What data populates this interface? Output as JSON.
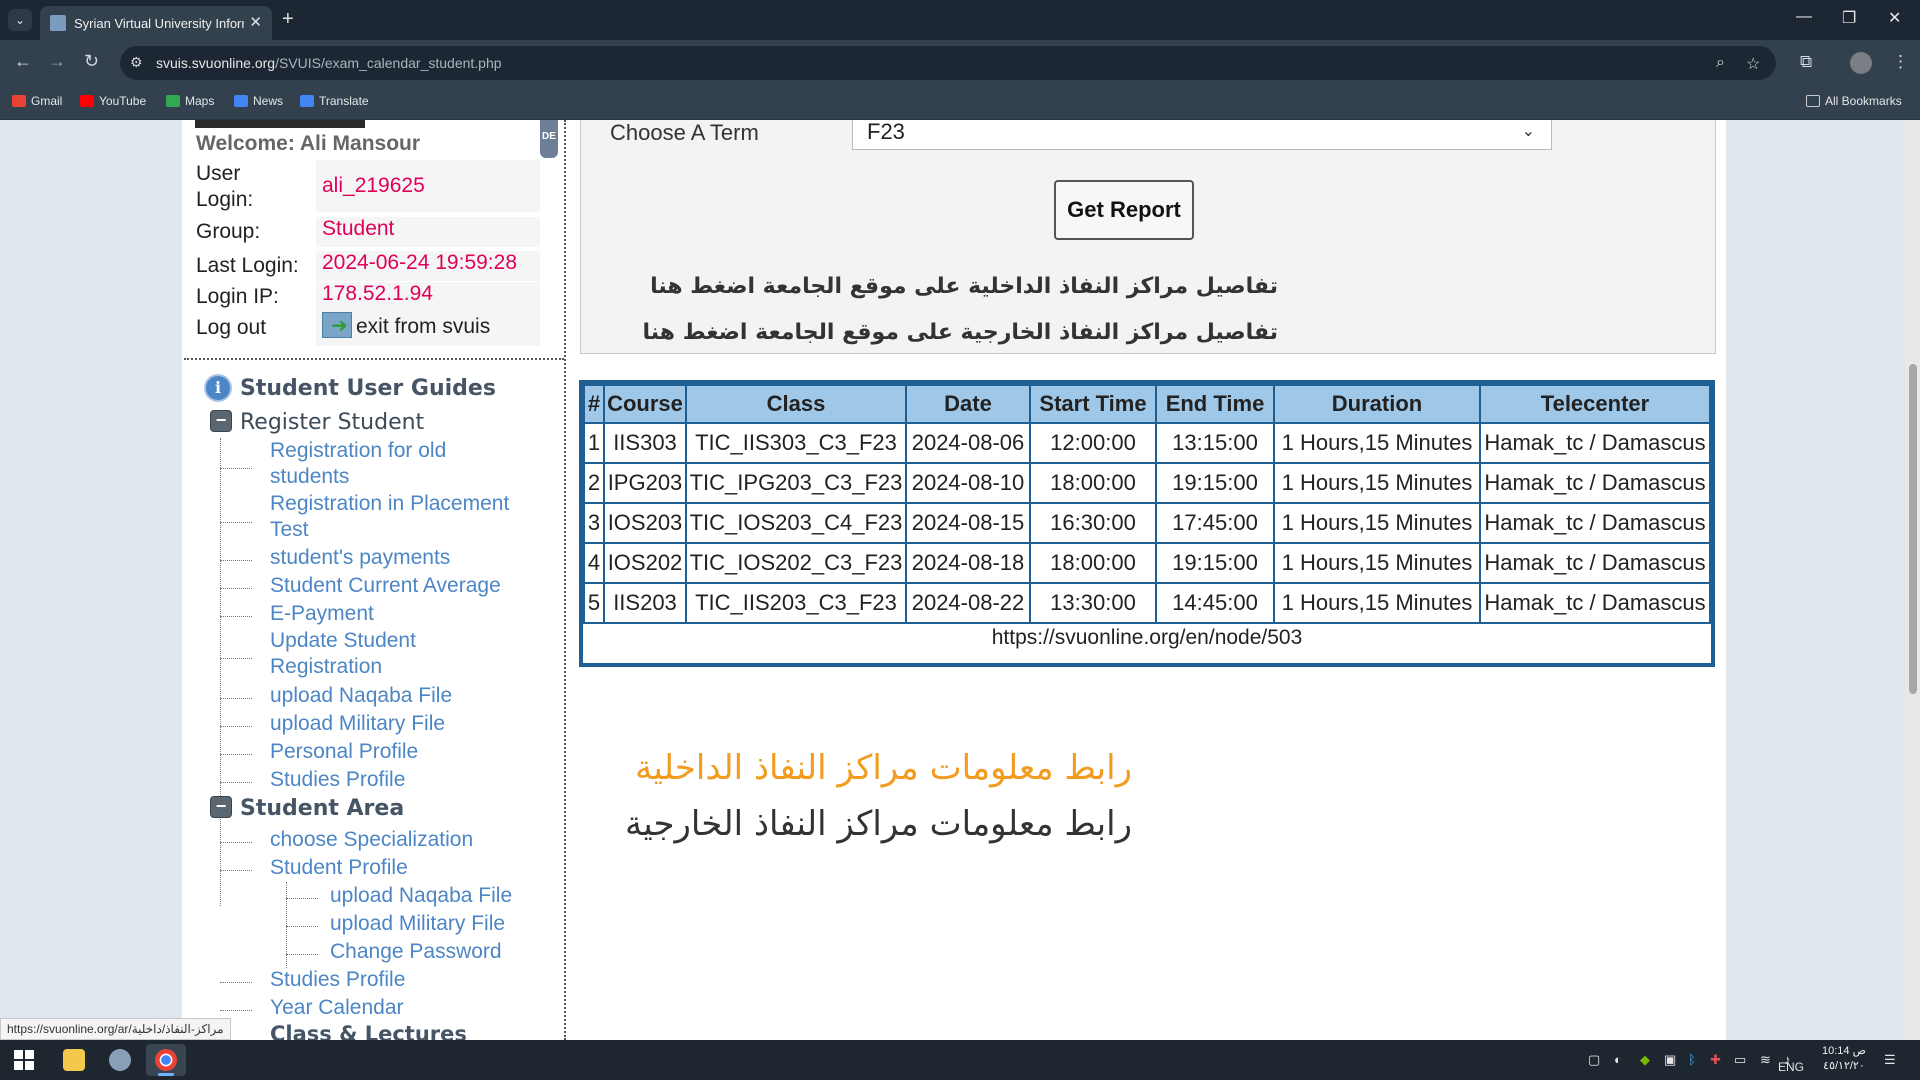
{
  "browser": {
    "tab_title": "Syrian Virtual University Informa",
    "new_tab": "+",
    "tab_close": "✕",
    "url_host": "svuis.svuonline.org",
    "url_path": "/SVUIS/exam_calendar_student.php",
    "window_controls": {
      "minimize": "—",
      "restore": "❐",
      "close": "✕"
    },
    "bookmarks": [
      {
        "label": "Gmail",
        "color": "#ea4335"
      },
      {
        "label": "YouTube",
        "color": "#ff0000"
      },
      {
        "label": "Maps",
        "color": "#34a853"
      },
      {
        "label": "News",
        "color": "#4285f4"
      },
      {
        "label": "Translate",
        "color": "#4285f4"
      }
    ],
    "all_bookmarks": "All Bookmarks"
  },
  "sidebar": {
    "side_tab": "DE",
    "welcome": "Welcome: Ali Mansour",
    "user_login_label_1": "User",
    "user_login_label_2": "Login:",
    "user_login": "ali_219625",
    "group_label": "Group:",
    "group": "Student",
    "last_login_label": "Last Login:",
    "last_login": "2024-06-24 19:59:28",
    "login_ip_label": "Login IP:",
    "login_ip": "178.52.1.94",
    "logout_label": "Log out",
    "logout_link": "exit from svuis",
    "guides_heading": "Student User Guides",
    "register_heading": "Register Student",
    "register_items": [
      "Registration for old",
      "students",
      "Registration in Placement",
      "Test",
      "student's payments",
      "Student Current Average",
      "E-Payment",
      "Update Student",
      "Registration",
      "upload Naqaba File",
      "upload Military File",
      "Personal Profile",
      "Studies Profile"
    ],
    "area_heading": "Student Area",
    "area_items": [
      "choose Specialization",
      "Student Profile"
    ],
    "profile_sub_items": [
      "upload Naqaba File",
      "upload Military File",
      "Change Password"
    ],
    "area_items_2": [
      "Studies Profile",
      "Year Calendar"
    ],
    "class_heading": "Class & Lectures"
  },
  "term": {
    "label": "Choose A Term",
    "selected": "F23",
    "button": "Get Report",
    "link_internal": "تفاصيل مراكز النفاذ الداخلية على موقع الجامعة اضغط هنا",
    "link_external": "تفاصيل مراكز النفاذ الخارجية على موقع الجامعة اضغط هنا"
  },
  "exam_table": {
    "headers": [
      "#",
      "Course",
      "Class",
      "Date",
      "Start Time",
      "End Time",
      "Duration",
      "Telecenter"
    ],
    "rows": [
      [
        "1",
        "IIS303",
        "TIC_IIS303_C3_F23",
        "2024-08-06",
        "12:00:00",
        "13:15:00",
        "1 Hours,15 Minutes",
        "Hamak_tc / Damascus"
      ],
      [
        "2",
        "IPG203",
        "TIC_IPG203_C3_F23",
        "2024-08-10",
        "18:00:00",
        "19:15:00",
        "1 Hours,15 Minutes",
        "Hamak_tc / Damascus"
      ],
      [
        "3",
        "IOS203",
        "TIC_IOS203_C4_F23",
        "2024-08-15",
        "16:30:00",
        "17:45:00",
        "1 Hours,15 Minutes",
        "Hamak_tc / Damascus"
      ],
      [
        "4",
        "IOS202",
        "TIC_IOS202_C3_F23",
        "2024-08-18",
        "18:00:00",
        "19:15:00",
        "1 Hours,15 Minutes",
        "Hamak_tc / Damascus"
      ],
      [
        "5",
        "IIS203",
        "TIC_IIS203_C3_F23",
        "2024-08-22",
        "13:30:00",
        "14:45:00",
        "1 Hours,15 Minutes",
        "Hamak_tc / Damascus"
      ]
    ],
    "footer_link": "https://svuonline.org/en/node/503"
  },
  "bottom_links": {
    "internal": "رابط معلومات مراكز النفاذ الداخلية",
    "external": "رابط معلومات مراكز النفاذ الخارجية"
  },
  "status_bar_url": "https://svuonline.org/ar/مراكز-النفاذ/داخلية",
  "taskbar": {
    "language": "ENG",
    "time": "10:14 ص",
    "date": "٤٥/١٢/٢٠"
  }
}
